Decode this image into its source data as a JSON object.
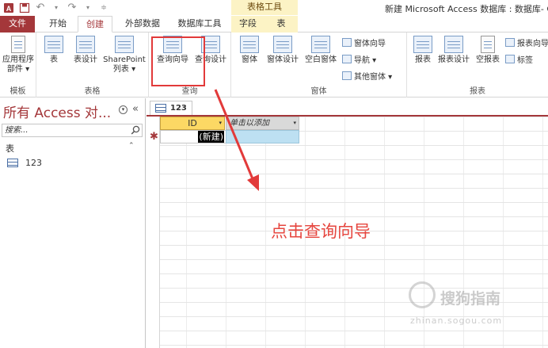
{
  "window": {
    "title": "新建 Microsoft Access 数据库 : 数据库- C",
    "context_group": "表格工具"
  },
  "tabs": [
    {
      "label": "文件"
    },
    {
      "label": "开始"
    },
    {
      "label": "创建"
    },
    {
      "label": "外部数据"
    },
    {
      "label": "数据库工具"
    },
    {
      "label": "字段"
    },
    {
      "label": "表"
    }
  ],
  "ribbon": {
    "templates": {
      "label": "模板",
      "app_parts_line1": "应用程序",
      "app_parts_line2": "部件 ▾"
    },
    "tables": {
      "label": "表格",
      "table": "表",
      "table_design": "表设计",
      "sharepoint_line1": "SharePoint",
      "sharepoint_line2": "列表 ▾"
    },
    "queries": {
      "label": "查询",
      "query_wizard": "查询向导",
      "query_design": "查询设计"
    },
    "forms": {
      "label": "窗体",
      "form": "窗体",
      "form_design": "窗体设计",
      "blank_form": "空白窗体",
      "form_wizard": "窗体向导",
      "navigation": "导航 ▾",
      "more_forms": "其他窗体 ▾"
    },
    "reports": {
      "label": "报表",
      "report": "报表",
      "report_design": "报表设计",
      "blank_report": "空报表",
      "report_wizard": "报表向导",
      "labels": "标签"
    }
  },
  "nav": {
    "title": "所有 Access 对...",
    "search_placeholder": "搜索...",
    "section": "表",
    "items": [
      {
        "label": "123"
      }
    ]
  },
  "document": {
    "tab_label": "123",
    "columns": [
      "ID",
      "单击以添加"
    ],
    "new_row_value": "(新建)",
    "new_row_marker": "✱"
  },
  "annotation": {
    "text": "点击查询向导"
  },
  "watermark": {
    "text": "搜狗指南",
    "url": "zhinan.sogou.com"
  },
  "colors": {
    "brand": "#a4373a",
    "annotation": "#e6463f",
    "header": "#fcd864",
    "context_tab": "#fcf3c5"
  }
}
